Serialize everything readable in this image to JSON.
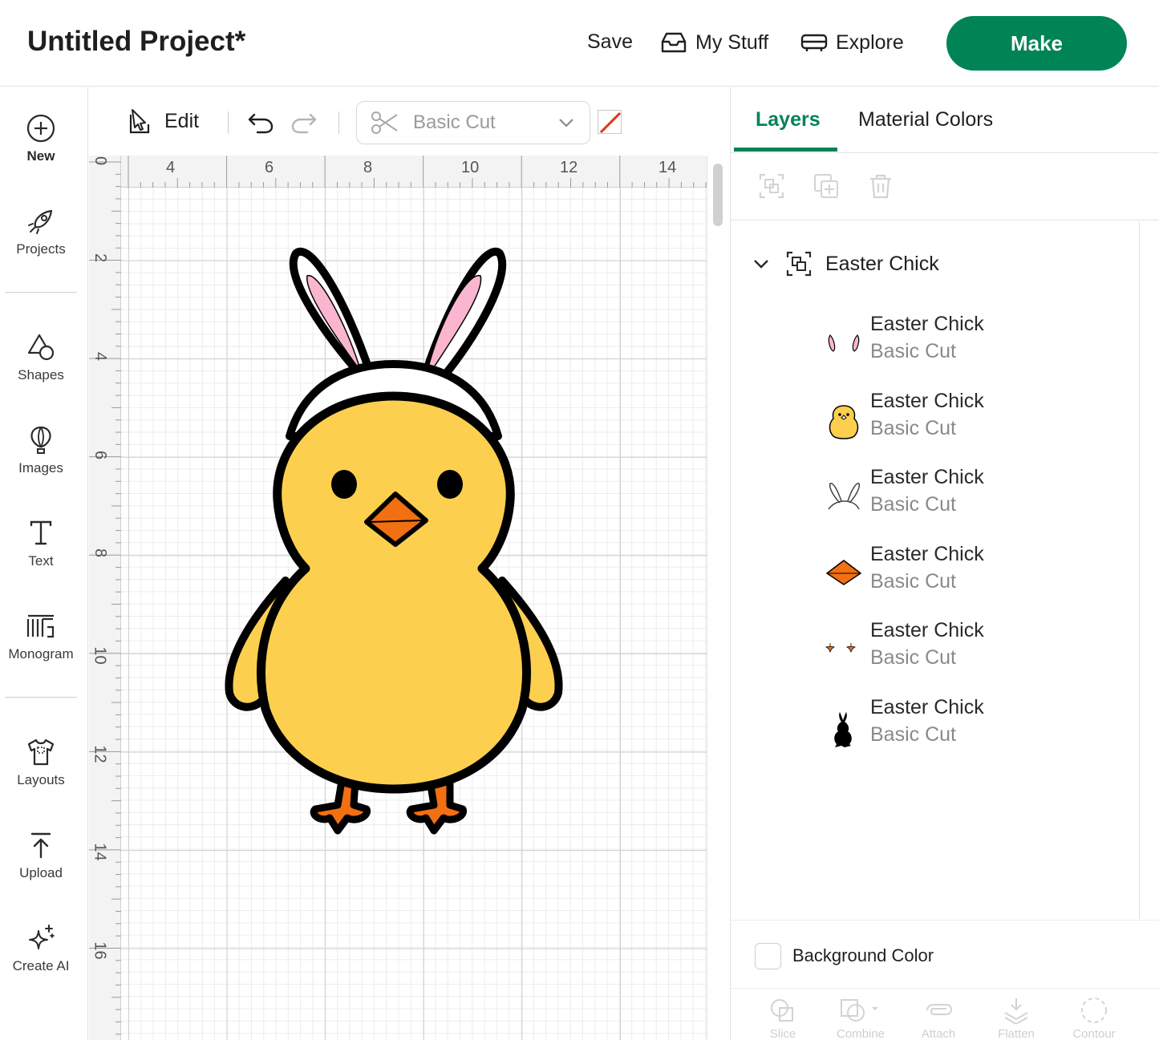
{
  "header": {
    "title": "Untitled Project*",
    "save_label": "Save",
    "my_stuff_label": "My Stuff",
    "explore_label": "Explore",
    "make_label": "Make"
  },
  "sidebar": {
    "items": [
      {
        "label": "New",
        "icon": "plus-circle-icon"
      },
      {
        "label": "Projects",
        "icon": "rocket-icon"
      },
      {
        "label": "Shapes",
        "icon": "shapes-icon"
      },
      {
        "label": "Images",
        "icon": "balloon-icon"
      },
      {
        "label": "Text",
        "icon": "text-icon"
      },
      {
        "label": "Monogram",
        "icon": "monogram-icon"
      },
      {
        "label": "Layouts",
        "icon": "tshirt-icon"
      },
      {
        "label": "Upload",
        "icon": "upload-icon"
      },
      {
        "label": "Create AI",
        "icon": "sparkle-icon"
      }
    ]
  },
  "toolbar": {
    "edit_label": "Edit",
    "operation": {
      "value": "Basic Cut",
      "icon": "scissors-icon"
    },
    "color_swatch": "none"
  },
  "rulers": {
    "top": [
      "4",
      "6",
      "8",
      "10",
      "12",
      "14"
    ],
    "left": [
      "0",
      "2",
      "4",
      "6",
      "8",
      "10",
      "12",
      "14",
      "16"
    ]
  },
  "panel": {
    "tabs": [
      "Layers",
      "Material Colors"
    ],
    "active_tab": "Layers",
    "group": {
      "name": "Easter Chick"
    },
    "layers": [
      {
        "name": "Easter Chick",
        "operation": "Basic Cut",
        "thumb": "pink-ears"
      },
      {
        "name": "Easter Chick",
        "operation": "Basic Cut",
        "thumb": "yellow-chick"
      },
      {
        "name": "Easter Chick",
        "operation": "Basic Cut",
        "thumb": "white-ears"
      },
      {
        "name": "Easter Chick",
        "operation": "Basic Cut",
        "thumb": "orange-beak"
      },
      {
        "name": "Easter Chick",
        "operation": "Basic Cut",
        "thumb": "orange-feet"
      },
      {
        "name": "Easter Chick",
        "operation": "Basic Cut",
        "thumb": "black-silhouette"
      }
    ],
    "background_color_label": "Background Color",
    "bottom_tools": [
      "Slice",
      "Combine",
      "Attach",
      "Flatten",
      "Contour"
    ]
  },
  "colors": {
    "accent": "#008456",
    "chick_body": "#fccf4f",
    "beak": "#f26f12",
    "ear_inner": "#fbb6cf",
    "outline": "#000000"
  }
}
